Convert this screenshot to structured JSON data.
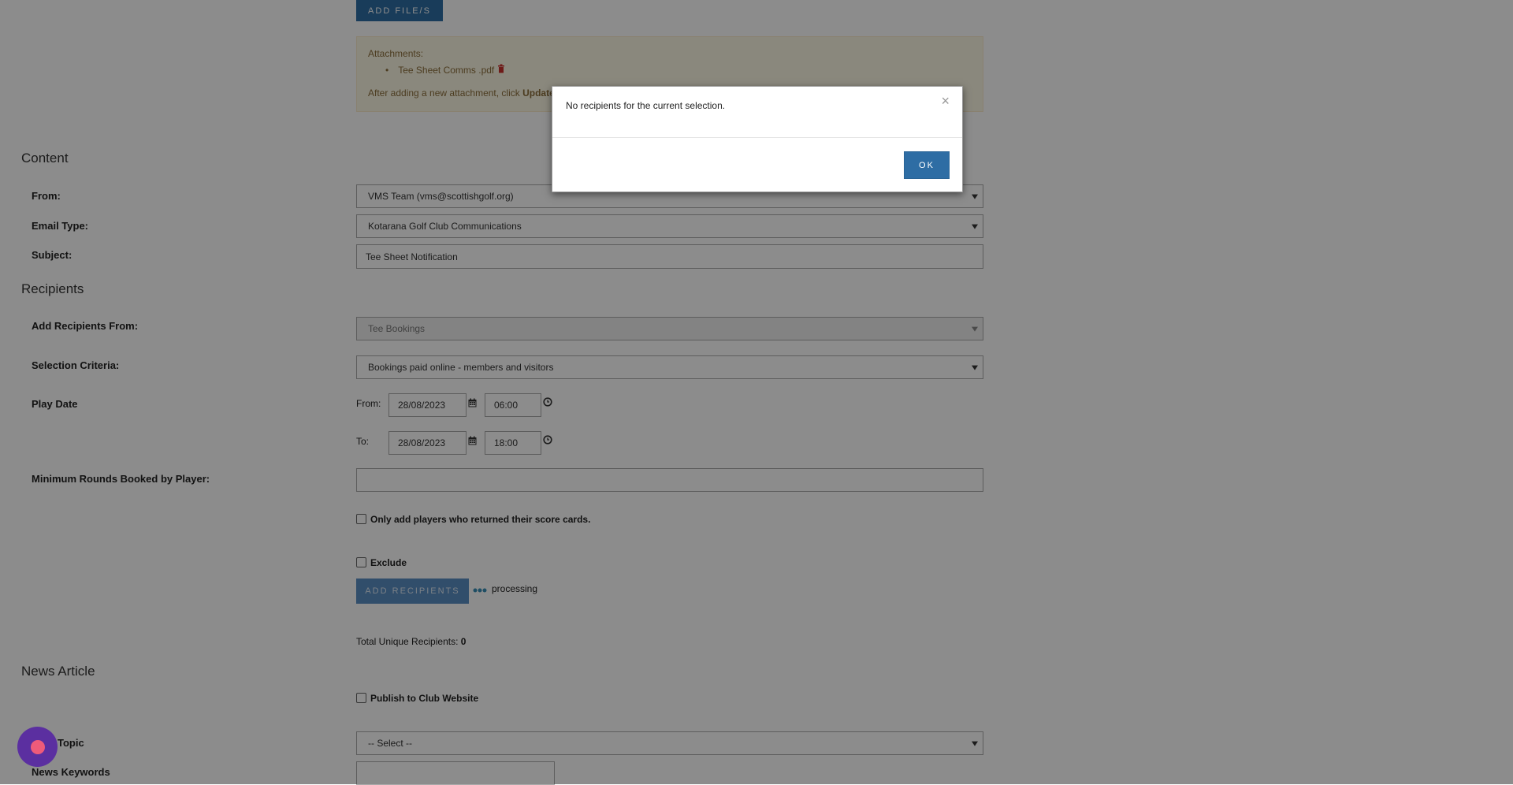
{
  "top": {
    "add_files_label": "ADD FILE/S"
  },
  "attachments": {
    "heading": "Attachments:",
    "items": [
      "Tee Sheet Comms .pdf"
    ],
    "note_prefix": "After adding a new attachment, click ",
    "note_link": "Update E"
  },
  "content": {
    "title": "Content",
    "from_label": "From:",
    "from_value": "VMS Team (vms@scottishgolf.org)",
    "email_type_label": "Email Type:",
    "email_type_value": "Kotarana Golf Club Communications",
    "subject_label": "Subject:",
    "subject_value": "Tee Sheet Notification"
  },
  "recipients": {
    "title": "Recipients",
    "add_from_label": "Add Recipients From:",
    "add_from_value": "Tee Bookings",
    "selection_label": "Selection Criteria:",
    "selection_value": "Bookings paid online - members and visitors",
    "play_date_label": "Play Date",
    "from_label": "From:",
    "from_date": "28/08/2023",
    "from_time": "06:00",
    "to_label": "To:",
    "to_date": "28/08/2023",
    "to_time": "18:00",
    "min_rounds_label": "Minimum Rounds Booked by Player:",
    "min_rounds_value": "",
    "scorecards_label": "Only add players who returned their score cards.",
    "exclude_label": "Exclude",
    "add_recipients_label": "ADD RECIPIENTS",
    "processing_label": "processing",
    "total_label": "Total Unique Recipients: ",
    "total_value": "0"
  },
  "news": {
    "title": "News Article",
    "publish_label": "Publish to Club Website",
    "topic_label": "Topic",
    "topic_value": "-- Select --",
    "keywords_label": "News Keywords",
    "keywords_value": ""
  },
  "modal": {
    "message": "No recipients for the current selection.",
    "close_symbol": "×",
    "ok_label": "OK"
  },
  "colors": {
    "primary_button": "#2e6da4",
    "overlay": "rgba(0,0,0,0.45)",
    "alert_bg": "#fcf8e3",
    "alert_text": "#8a6d3b"
  }
}
